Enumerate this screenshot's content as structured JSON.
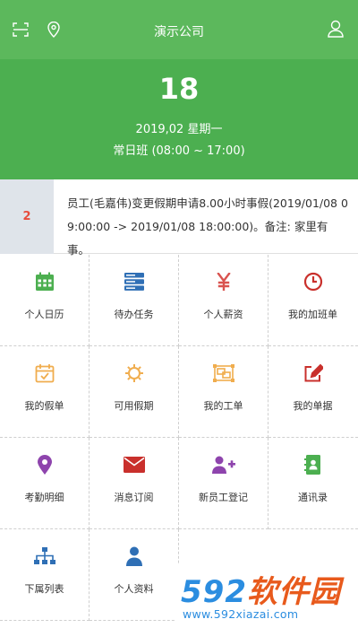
{
  "app": {
    "title": "演示公司"
  },
  "header": {
    "day": "18",
    "date_text": "2019,02 星期一",
    "shift_text": "常日班 (08:00 ~ 17:00)"
  },
  "notice": {
    "count": "2",
    "message": "员工(毛嘉伟)变更假期申请8.00小时事假(2019/01/08 09:00:00 -> 2019/01/08 18:00:00)。备注: 家里有事。"
  },
  "menu": [
    {
      "label": "个人日历",
      "icon": "calendar-icon",
      "color": "#4caf50"
    },
    {
      "label": "待办任务",
      "icon": "server-icon",
      "color": "#2f6fb5"
    },
    {
      "label": "个人薪资",
      "icon": "yen-icon",
      "color": "#d9534f"
    },
    {
      "label": "我的加班单",
      "icon": "clock-icon",
      "color": "#c9302c"
    },
    {
      "label": "我的假单",
      "icon": "calendar-check-icon",
      "color": "#f0ad4e"
    },
    {
      "label": "可用假期",
      "icon": "gear-icon",
      "color": "#f0ad4e"
    },
    {
      "label": "我的工单",
      "icon": "object-group-icon",
      "color": "#f0ad4e"
    },
    {
      "label": "我的单据",
      "icon": "edit-icon",
      "color": "#c9302c"
    },
    {
      "label": "考勤明细",
      "icon": "map-marker-icon",
      "color": "#8e44ad"
    },
    {
      "label": "消息订阅",
      "icon": "envelope-icon",
      "color": "#c9302c"
    },
    {
      "label": "新员工登记",
      "icon": "user-plus-icon",
      "color": "#8e44ad"
    },
    {
      "label": "通讯录",
      "icon": "address-book-icon",
      "color": "#4caf50"
    },
    {
      "label": "下属列表",
      "icon": "sitemap-icon",
      "color": "#2f6fb5"
    },
    {
      "label": "个人资料",
      "icon": "user-icon",
      "color": "#2f6fb5"
    }
  ],
  "watermark": {
    "brand_number": "592",
    "brand_text": "软件园",
    "url": "www.592xiazai.com"
  }
}
